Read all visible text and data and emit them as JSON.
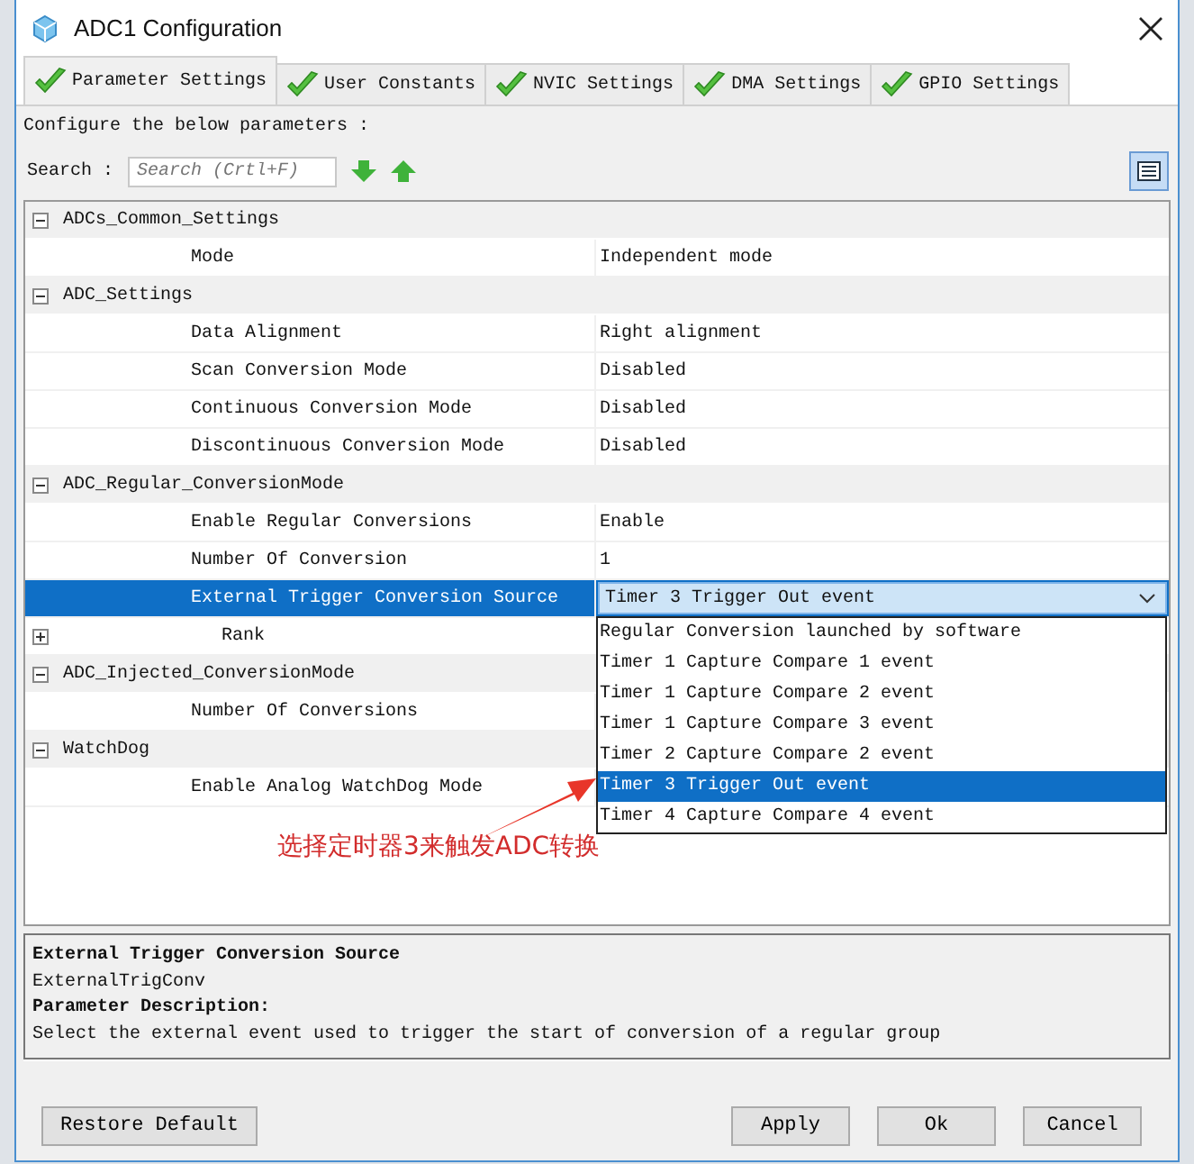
{
  "window": {
    "title": "ADC1 Configuration"
  },
  "tabs": [
    {
      "label": "Parameter Settings",
      "selected": true
    },
    {
      "label": "User Constants",
      "selected": false
    },
    {
      "label": "NVIC Settings",
      "selected": false
    },
    {
      "label": "DMA Settings",
      "selected": false
    },
    {
      "label": "GPIO Settings",
      "selected": false
    }
  ],
  "instruction": "Configure the below parameters :",
  "search": {
    "label": "Search :",
    "placeholder": "Search (Crtl+F)"
  },
  "tree": [
    {
      "label": "ADCs_Common_Settings",
      "expanded": true,
      "children": [
        {
          "kind": "param",
          "name": "Mode",
          "value": "Independent mode",
          "selected": false
        }
      ]
    },
    {
      "label": "ADC_Settings",
      "expanded": true,
      "children": [
        {
          "kind": "param",
          "name": "Data Alignment",
          "value": "Right alignment",
          "selected": false
        },
        {
          "kind": "param",
          "name": "Scan Conversion Mode",
          "value": "Disabled",
          "selected": false
        },
        {
          "kind": "param",
          "name": "Continuous Conversion Mode",
          "value": "Disabled",
          "selected": false
        },
        {
          "kind": "param",
          "name": "Discontinuous Conversion Mode",
          "value": "Disabled",
          "selected": false
        }
      ]
    },
    {
      "label": "ADC_Regular_ConversionMode",
      "expanded": true,
      "children": [
        {
          "kind": "param",
          "name": "Enable Regular Conversions",
          "value": "Enable",
          "selected": false
        },
        {
          "kind": "param",
          "name": "Number Of Conversion",
          "value": "1",
          "selected": false
        },
        {
          "kind": "param",
          "name": "External Trigger Conversion Source",
          "value": "Timer 3 Trigger Out event",
          "selected": true,
          "dropdown": {
            "options": [
              {
                "label": "Regular Conversion launched by software",
                "selected": false
              },
              {
                "label": "Timer 1 Capture Compare 1 event",
                "selected": false
              },
              {
                "label": "Timer 1 Capture Compare 2 event",
                "selected": false
              },
              {
                "label": "Timer 1 Capture Compare 3 event",
                "selected": false
              },
              {
                "label": "Timer 2 Capture Compare 2 event",
                "selected": false
              },
              {
                "label": "Timer 3 Trigger Out event",
                "selected": true
              },
              {
                "label": "Timer 4 Capture Compare 4 event",
                "selected": false
              }
            ]
          }
        },
        {
          "kind": "subgroup",
          "name": "Rank",
          "expanded": false,
          "selected": false
        }
      ]
    },
    {
      "label": "ADC_Injected_ConversionMode",
      "expanded": true,
      "children": [
        {
          "kind": "param",
          "name": "Number Of Conversions",
          "selected": false
        }
      ]
    },
    {
      "label": "WatchDog",
      "expanded": true,
      "children": [
        {
          "kind": "param",
          "name": "Enable Analog WatchDog Mode",
          "selected": false
        }
      ]
    }
  ],
  "annotation": {
    "text": "选择定时器3来触发ADC转换"
  },
  "description": {
    "title": "External Trigger Conversion Source",
    "param": "ExternalTrigConv",
    "heading": "Parameter Description:",
    "text": "Select the external event used to trigger the start of conversion of a regular group"
  },
  "buttons_left": [
    {
      "label": "Restore Default"
    }
  ],
  "buttons_right": [
    {
      "label": "Apply"
    },
    {
      "label": "Ok"
    },
    {
      "label": "Cancel"
    }
  ]
}
